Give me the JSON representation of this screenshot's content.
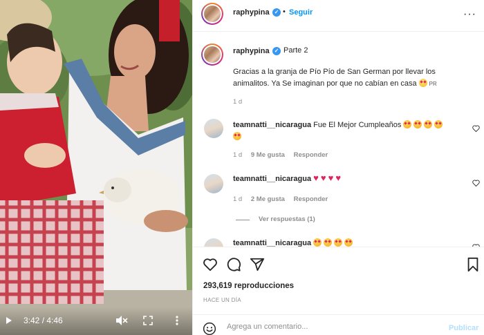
{
  "video": {
    "time": "3:42 / 4:46"
  },
  "header": {
    "username": "raphypina",
    "follow_label": "Seguir"
  },
  "caption": {
    "username": "raphypina",
    "title": "Parte 2",
    "text": "Gracias a la granja de Pío Pío de San German por llevar los animalitos. Ya Se imaginan por que no cabían en casa",
    "suffix": "PR",
    "time": "1 d"
  },
  "comments": [
    {
      "username": "teamnatti__nicaragua",
      "text": "Fue El Mejor Cumpleaños",
      "time": "1 d",
      "likes": "9 Me gusta",
      "reply": "Responder"
    },
    {
      "username": "teamnatti__nicaragua",
      "text": "",
      "time": "1 d",
      "likes": "2 Me gusta",
      "reply": "Responder"
    },
    {
      "username": "teamnatti__nicaragua",
      "text": ""
    }
  ],
  "view_replies": "Ver respuestas (1)",
  "stats": {
    "views": "293,619 reproducciones",
    "ago": "HACE UN DÍA"
  },
  "add_comment": {
    "placeholder": "Agrega un comentario...",
    "post_label": "Publicar"
  },
  "colors": {
    "accent": "#0095f6",
    "verified": "#3897f0"
  }
}
